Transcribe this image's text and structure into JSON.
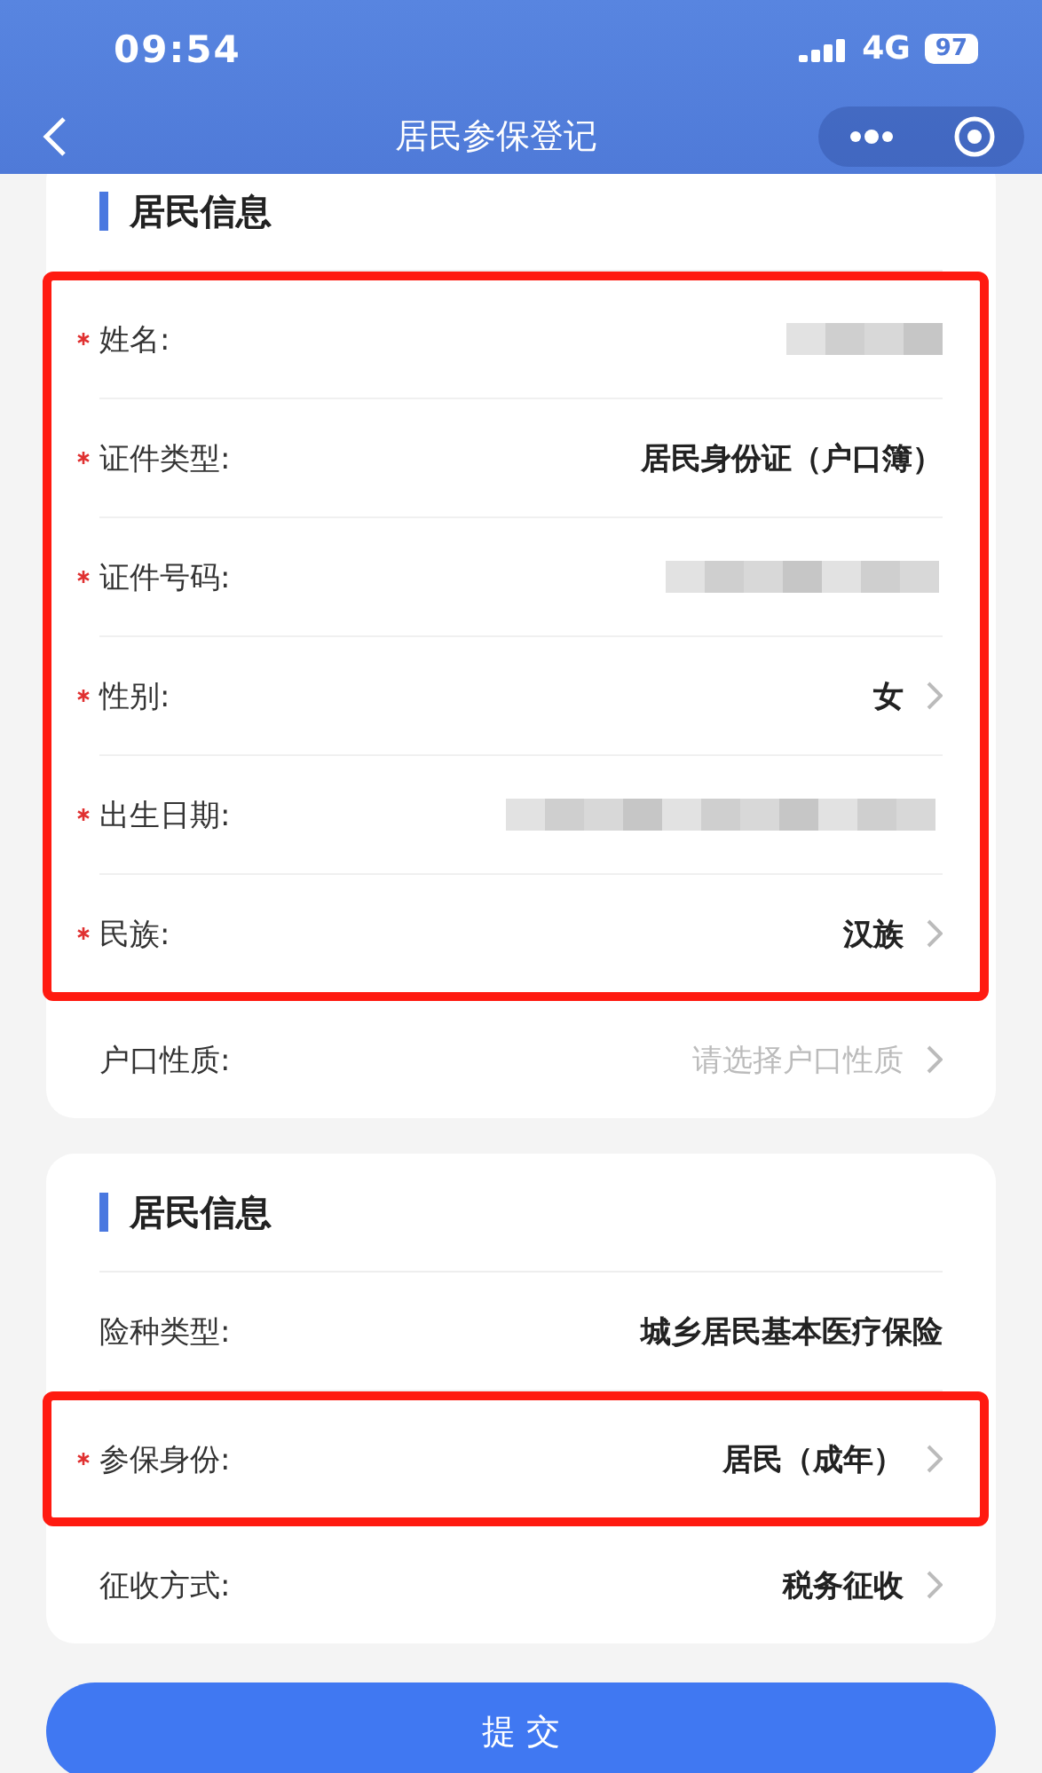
{
  "status_bar": {
    "time": "09:54",
    "network": "4G",
    "battery": "97"
  },
  "nav": {
    "title": "居民参保登记"
  },
  "cards": [
    {
      "title": "居民信息",
      "blocks": [
        {
          "highlighted": true,
          "fields": [
            {
              "label": "姓名:",
              "required": true,
              "kind": "blurred",
              "chevron": false
            },
            {
              "label": "证件类型:",
              "required": true,
              "kind": "text",
              "value": "居民身份证（户口簿）",
              "chevron": false
            },
            {
              "label": "证件号码:",
              "required": true,
              "kind": "blurred",
              "chevron": false
            },
            {
              "label": "性别:",
              "required": true,
              "kind": "text",
              "value": "女",
              "chevron": true
            },
            {
              "label": "出生日期:",
              "required": true,
              "kind": "blurred",
              "chevron": false
            },
            {
              "label": "民族:",
              "required": true,
              "kind": "text",
              "value": "汉族",
              "chevron": true
            }
          ]
        },
        {
          "highlighted": false,
          "fields": [
            {
              "label": "户口性质:",
              "required": false,
              "kind": "select",
              "placeholder": "请选择户口性质",
              "chevron": true
            }
          ]
        }
      ]
    },
    {
      "title": "居民信息",
      "blocks": [
        {
          "highlighted": false,
          "fields": [
            {
              "label": "险种类型:",
              "required": false,
              "kind": "text",
              "value": "城乡居民基本医疗保险",
              "chevron": false
            }
          ]
        },
        {
          "highlighted": true,
          "fields": [
            {
              "label": "参保身份:",
              "required": true,
              "kind": "text",
              "value": "居民（成年）",
              "chevron": true
            }
          ]
        },
        {
          "highlighted": false,
          "fields": [
            {
              "label": "征收方式:",
              "required": false,
              "kind": "text",
              "value": "税务征收",
              "chevron": true
            }
          ]
        }
      ]
    }
  ],
  "submit": "提 交"
}
